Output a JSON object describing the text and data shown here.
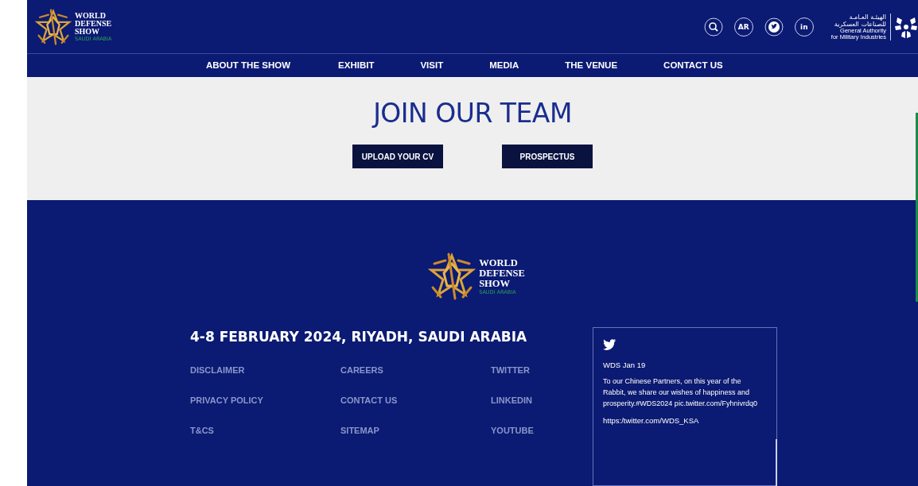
{
  "header": {
    "logo": {
      "lines": [
        "WORLD",
        "DEFENSE",
        "SHOW"
      ],
      "tagline": "SAUDI ARABIA"
    },
    "actions": [
      {
        "kind": "search"
      },
      {
        "kind": "text",
        "label": "AR"
      },
      {
        "kind": "twitter"
      },
      {
        "kind": "text",
        "label": "in"
      }
    ],
    "authority": {
      "arabic": [
        "الهيئـة العـامـة",
        "للصناعات العسكرية"
      ],
      "english": [
        "General Authority",
        "for Military Industries"
      ]
    }
  },
  "nav": [
    "ABOUT THE SHOW",
    "EXHIBIT",
    "VISIT",
    "MEDIA",
    "THE VENUE",
    "CONTACT US"
  ],
  "hero": {
    "title": "JOIN OUR TEAM",
    "buttons": [
      "UPLOAD YOUR CV",
      "PROSPECTUS"
    ]
  },
  "footer": {
    "logo": {
      "lines": [
        "WORLD",
        "DEFENSE",
        "SHOW"
      ],
      "tagline": "SAUDI ARABIA"
    },
    "event": "4-8 FEBRUARY 2024, RIYADH, SAUDI ARABIA",
    "links": [
      [
        "DISCLAIMER",
        "CAREERS",
        "TWITTER"
      ],
      [
        "PRIVACY POLICY",
        "CONTACT US",
        "LINKEDIN"
      ],
      [
        "T&CS",
        "SITEMAP",
        "YOUTUBE"
      ]
    ],
    "tweet": {
      "meta": "WDS Jan 19",
      "text": "To our Chinese Partners, on this year of the Rabbit, we share our wishes of happiness and prosperity.#WDS2024 pic.twitter.com/Fyhnivrdq0",
      "link": "https:/twitter.com/WDS_KSA"
    }
  }
}
